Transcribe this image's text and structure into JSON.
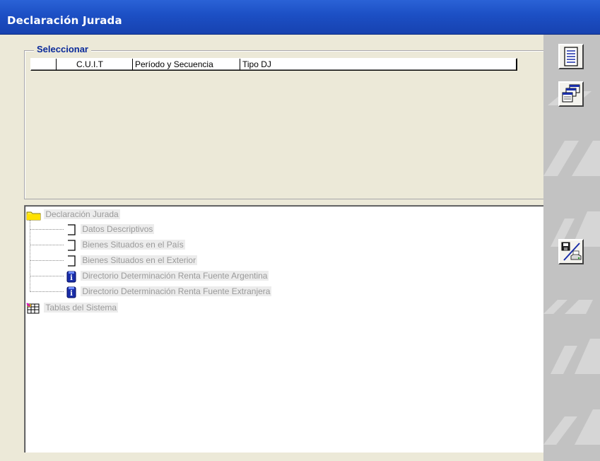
{
  "window": {
    "title": "Declaración Jurada"
  },
  "selector": {
    "legend": "Seleccionar",
    "columns": [
      "",
      "C.U.I.T",
      "Período y Secuencia",
      "Tipo DJ",
      ""
    ]
  },
  "tree": {
    "root": {
      "label": "Declaración Jurada",
      "icon": "folder-icon",
      "children": [
        {
          "label": "Datos Descriptivos",
          "icon": "page-icon"
        },
        {
          "label": "Bienes Situados en el País",
          "icon": "page-icon"
        },
        {
          "label": "Bienes Situados en el Exterior",
          "icon": "page-icon"
        },
        {
          "label": "Directorio Determinación Renta Fuente Argentina",
          "icon": "info-book-icon"
        },
        {
          "label": "Directorio Determinación Renta Fuente Extranjera",
          "icon": "info-book-icon"
        }
      ]
    },
    "tables": {
      "label": "Tablas del Sistema",
      "icon": "tables-icon"
    }
  },
  "toolbar": {
    "buttons": [
      {
        "name": "document-list-button",
        "icon": "document-lines-icon"
      },
      {
        "name": "windows-cascade-button",
        "icon": "windows-icon"
      },
      {
        "name": "save-print-button",
        "icon": "disk-printer-icon"
      }
    ]
  },
  "colors": {
    "titlebar": "#1c4fc4",
    "legend": "#0a2a9a",
    "panel": "#ece9d8",
    "sidebar": "#c2c2c2"
  }
}
